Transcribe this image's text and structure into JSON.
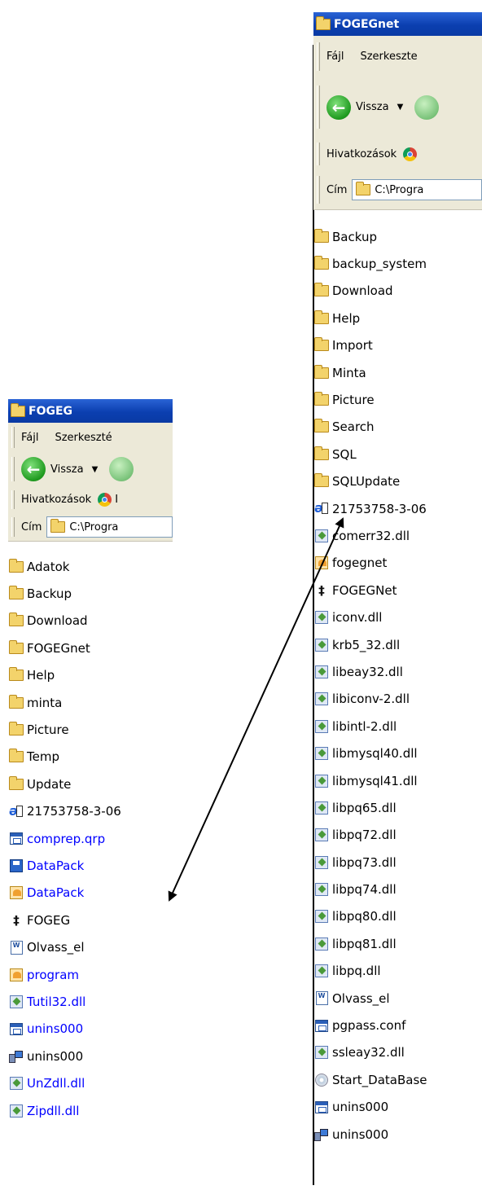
{
  "left_window": {
    "title": "FOGEG",
    "menu": [
      "Fájl",
      "Szerkeszté"
    ],
    "back_label": "Vissza",
    "links_label": "Hivatkozások",
    "links_trail": "I",
    "address_label": "Cím",
    "address_value": "C:\\Progra",
    "items": [
      {
        "name": "Adatok",
        "icon": "folder-icon",
        "blue": false
      },
      {
        "name": "Backup",
        "icon": "folder-icon",
        "blue": false
      },
      {
        "name": "Download",
        "icon": "folder-icon",
        "blue": false
      },
      {
        "name": "FOGEGnet",
        "icon": "folder-icon",
        "blue": false
      },
      {
        "name": "Help",
        "icon": "folder-icon",
        "blue": false
      },
      {
        "name": "minta",
        "icon": "folder-icon",
        "blue": false
      },
      {
        "name": "Picture",
        "icon": "folder-icon",
        "blue": false
      },
      {
        "name": "Temp",
        "icon": "folder-icon",
        "blue": false
      },
      {
        "name": "Update",
        "icon": "folder-icon",
        "blue": false
      },
      {
        "name": "21753758-3-06",
        "icon": "internet-shortcut-icon",
        "blue": false
      },
      {
        "name": "comprep.qrp",
        "icon": "window-file-icon",
        "blue": true
      },
      {
        "name": "DataPack",
        "icon": "save-disk-icon",
        "blue": true
      },
      {
        "name": "DataPack",
        "icon": "application-icon",
        "blue": true
      },
      {
        "name": "FOGEG",
        "icon": "tool-icon",
        "blue": false
      },
      {
        "name": "Olvass_el",
        "icon": "document-icon",
        "blue": false
      },
      {
        "name": "program",
        "icon": "application-icon",
        "blue": true
      },
      {
        "name": "Tutil32.dll",
        "icon": "dll-icon",
        "blue": true
      },
      {
        "name": "unins000",
        "icon": "window-file-icon",
        "blue": true
      },
      {
        "name": "unins000",
        "icon": "setup-icon",
        "blue": false
      },
      {
        "name": "UnZdll.dll",
        "icon": "dll-icon",
        "blue": true
      },
      {
        "name": "Zipdll.dll",
        "icon": "dll-icon",
        "blue": true
      }
    ]
  },
  "right_window": {
    "title": "FOGEGnet",
    "menu": [
      "Fájl",
      "Szerkeszte"
    ],
    "back_label": "Vissza",
    "links_label": "Hivatkozások",
    "links_trail": "",
    "address_label": "Cím",
    "address_value": "C:\\Progra",
    "items": [
      {
        "name": "Backup",
        "icon": "folder-icon",
        "blue": false
      },
      {
        "name": "backup_system",
        "icon": "folder-icon",
        "blue": false
      },
      {
        "name": "Download",
        "icon": "folder-icon",
        "blue": false
      },
      {
        "name": "Help",
        "icon": "folder-icon",
        "blue": false
      },
      {
        "name": "Import",
        "icon": "folder-icon",
        "blue": false
      },
      {
        "name": "Minta",
        "icon": "folder-icon",
        "blue": false
      },
      {
        "name": "Picture",
        "icon": "folder-icon",
        "blue": false
      },
      {
        "name": "Search",
        "icon": "folder-icon",
        "blue": false
      },
      {
        "name": "SQL",
        "icon": "folder-icon",
        "blue": false
      },
      {
        "name": "SQLUpdate",
        "icon": "folder-icon",
        "blue": false
      },
      {
        "name": "21753758-3-06",
        "icon": "internet-shortcut-icon",
        "blue": false
      },
      {
        "name": "comerr32.dll",
        "icon": "dll-icon",
        "blue": false
      },
      {
        "name": "fogegnet",
        "icon": "application-icon",
        "blue": false
      },
      {
        "name": "FOGEGNet",
        "icon": "tool-icon",
        "blue": false
      },
      {
        "name": "iconv.dll",
        "icon": "dll-icon",
        "blue": false
      },
      {
        "name": "krb5_32.dll",
        "icon": "dll-icon",
        "blue": false
      },
      {
        "name": "libeay32.dll",
        "icon": "dll-icon",
        "blue": false
      },
      {
        "name": "libiconv-2.dll",
        "icon": "dll-icon",
        "blue": false
      },
      {
        "name": "libintl-2.dll",
        "icon": "dll-icon",
        "blue": false
      },
      {
        "name": "libmysql40.dll",
        "icon": "dll-icon",
        "blue": false
      },
      {
        "name": "libmysql41.dll",
        "icon": "dll-icon",
        "blue": false
      },
      {
        "name": "libpq65.dll",
        "icon": "dll-icon",
        "blue": false
      },
      {
        "name": "libpq72.dll",
        "icon": "dll-icon",
        "blue": false
      },
      {
        "name": "libpq73.dll",
        "icon": "dll-icon",
        "blue": false
      },
      {
        "name": "libpq74.dll",
        "icon": "dll-icon",
        "blue": false
      },
      {
        "name": "libpq80.dll",
        "icon": "dll-icon",
        "blue": false
      },
      {
        "name": "libpq81.dll",
        "icon": "dll-icon",
        "blue": false
      },
      {
        "name": "libpq.dll",
        "icon": "dll-icon",
        "blue": false
      },
      {
        "name": "Olvass_el",
        "icon": "document-icon",
        "blue": false
      },
      {
        "name": "pgpass.conf",
        "icon": "window-file-icon",
        "blue": false
      },
      {
        "name": "ssleay32.dll",
        "icon": "dll-icon",
        "blue": false
      },
      {
        "name": "Start_DataBase",
        "icon": "cdrom-icon",
        "blue": false
      },
      {
        "name": "unins000",
        "icon": "window-file-icon",
        "blue": false
      },
      {
        "name": "unins000",
        "icon": "setup-icon",
        "blue": false
      }
    ]
  },
  "colors": {
    "titlebar": "#0b3fb0",
    "toolbar": "#ece9d8",
    "link_blue": "#0000ff"
  }
}
